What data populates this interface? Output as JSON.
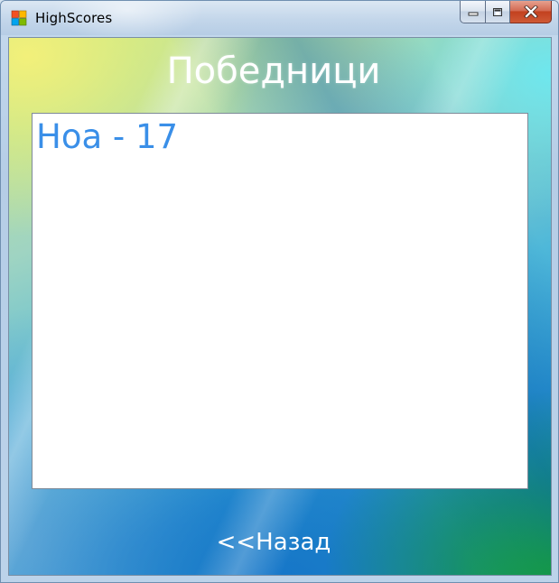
{
  "window": {
    "title": "HighScores",
    "icon": "windows-form-icon",
    "controls": {
      "minimize": "minimize-icon",
      "maximize": "maximize-icon",
      "close": "close-icon"
    },
    "close_color": "#c7442a"
  },
  "main": {
    "heading": "Победници",
    "scores": [
      "Ноа - 17"
    ],
    "score_color": "#3a8fe8",
    "back_label": "<<Назад"
  }
}
